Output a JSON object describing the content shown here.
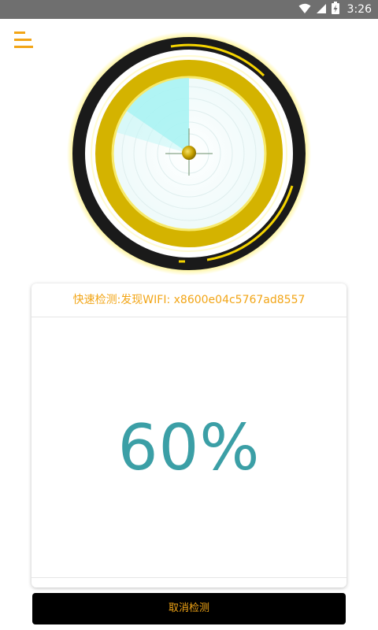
{
  "status_bar": {
    "time": "3:26",
    "icons": [
      "wifi-icon",
      "signal-icon",
      "battery-charging-icon"
    ]
  },
  "menu": {
    "icon": "hamburger-menu-icon"
  },
  "radar": {
    "colors": {
      "outer_ring": "#1a1a1a",
      "accent": "#f5d400",
      "sweep": "#a8f3f3",
      "core": "#d4b300"
    }
  },
  "card": {
    "header": "快速检测:发现WIFI: x8600e04c5767ad8557",
    "progress_text": "60%"
  },
  "cancel_button": {
    "label": "取消检测"
  },
  "colors": {
    "accent": "#f2a516",
    "percent": "#3b9fa6",
    "status_bar": "#6f6f6f"
  }
}
